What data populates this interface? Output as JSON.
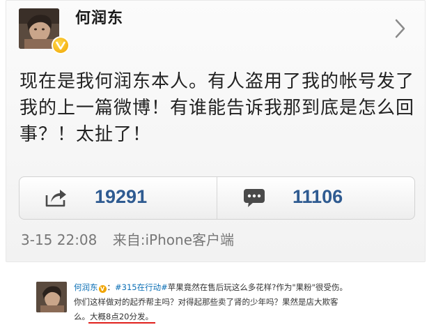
{
  "post": {
    "username": "何润东",
    "text": "现在是我何润东本人。有人盗用了我的帐号发了我的上一篇微博！有谁能告诉我那到底是怎么回事？！太扯了！",
    "reposts": "19291",
    "comments": "11106",
    "timestamp": "3-15 22:08",
    "source": "来自:iPhone客户端"
  },
  "embedded_post": {
    "username": "何润东",
    "separator": "：",
    "hashtag": "#315在行动#",
    "line1_rest": "苹果竟然在售后玩这么多花样?作为\"果粉\"很受伤。",
    "line2": "你们这样做对的起乔帮主吗？对得起那些卖了肾的少年吗？果然是店大欺客",
    "line3_prefix": "么。",
    "line3_highlight": "大概8点20分发。"
  },
  "icons": {
    "verified_badge": "verified-v-badge-icon",
    "repost": "repost-share-icon",
    "comment": "comment-bubble-icon",
    "chevron": "chevron-right-icon"
  },
  "colors": {
    "count_blue": "#2f5b91",
    "badge_gold": "#f0a400",
    "link_blue": "#0b6fb5",
    "underline_red": "#e0201c"
  }
}
